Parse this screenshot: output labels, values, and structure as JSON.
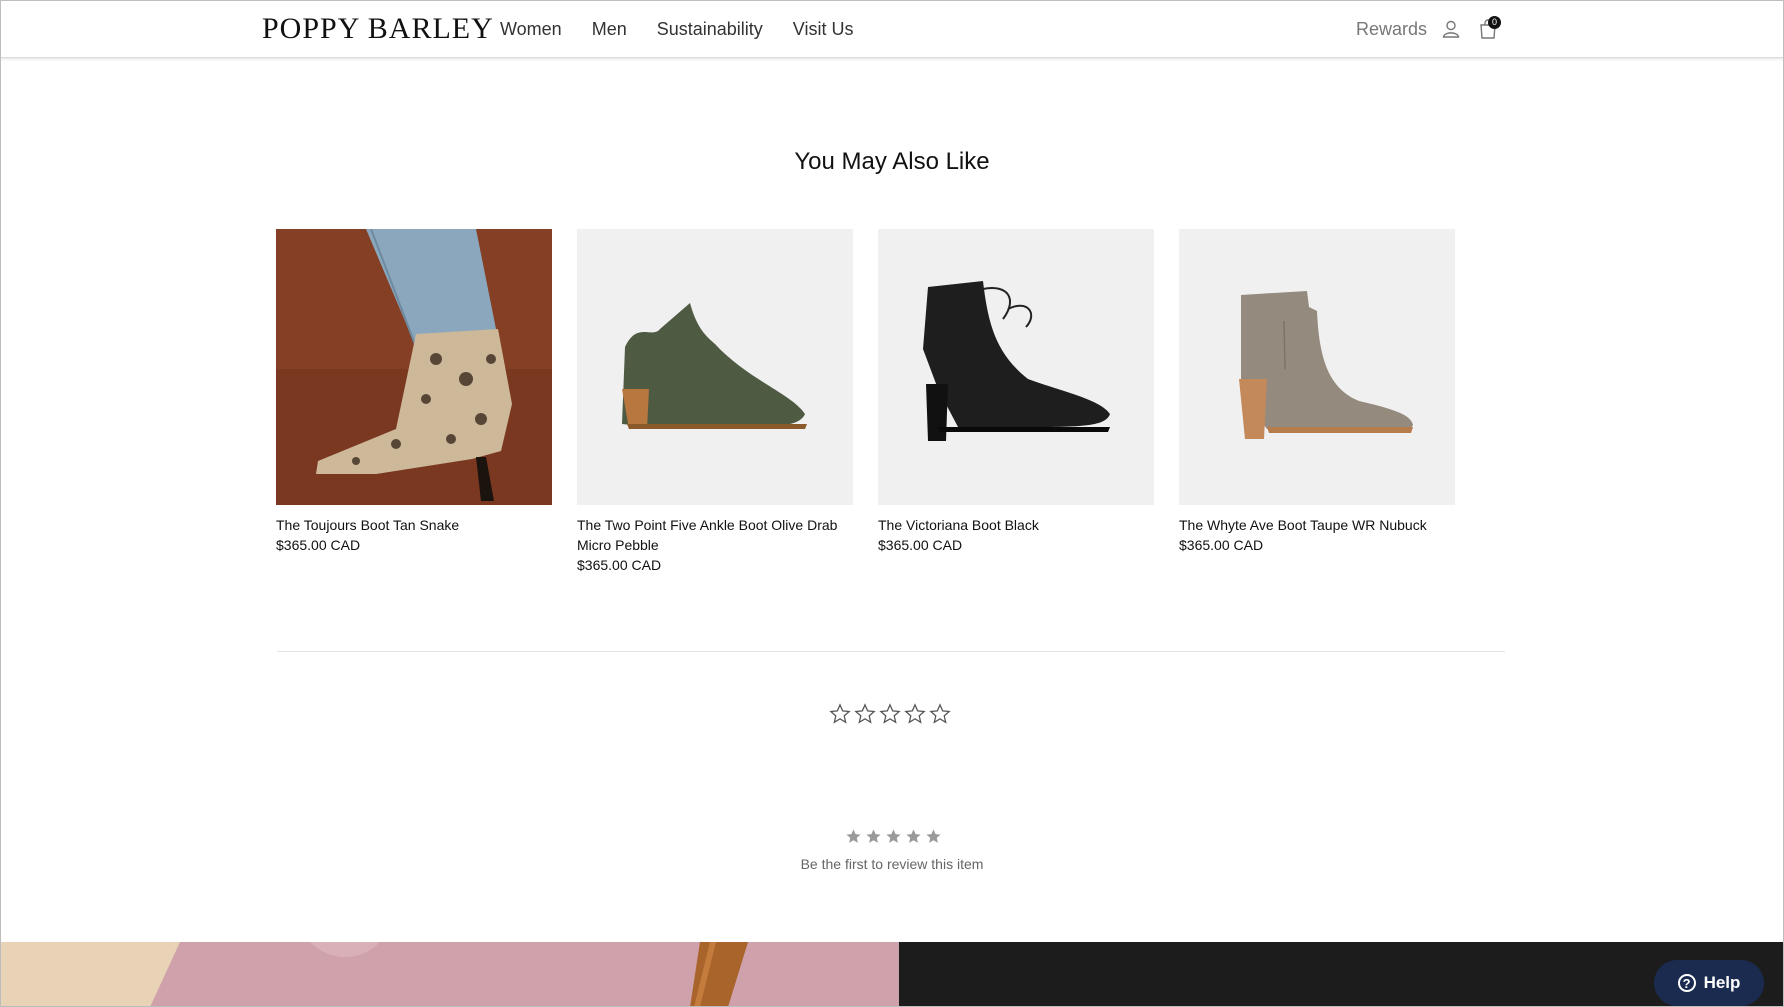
{
  "header": {
    "logo": "POPPY BARLEY",
    "nav": [
      "Women",
      "Men",
      "Sustainability",
      "Visit Us"
    ],
    "rewards": "Rewards",
    "cart_count": "0"
  },
  "recommendations": {
    "title": "You May Also Like",
    "products": [
      {
        "name": "The Toujours Boot Tan Snake",
        "price": "$365.00 CAD"
      },
      {
        "name": "The Two Point Five Ankle Boot Olive Drab Micro Pebble",
        "price": "$365.00 CAD"
      },
      {
        "name": "The Victoriana Boot Black",
        "price": "$365.00 CAD"
      },
      {
        "name": "The Whyte Ave Boot Taupe WR Nubuck",
        "price": "$365.00 CAD"
      }
    ]
  },
  "reviews": {
    "prompt": "Be the first to review this item",
    "rating_count_shown": 0
  },
  "help": {
    "label": "Help"
  },
  "colors": {
    "star_outline": "#555555",
    "star_fill_grey": "#9a9a9a",
    "help_bg": "#1a2b4f"
  }
}
